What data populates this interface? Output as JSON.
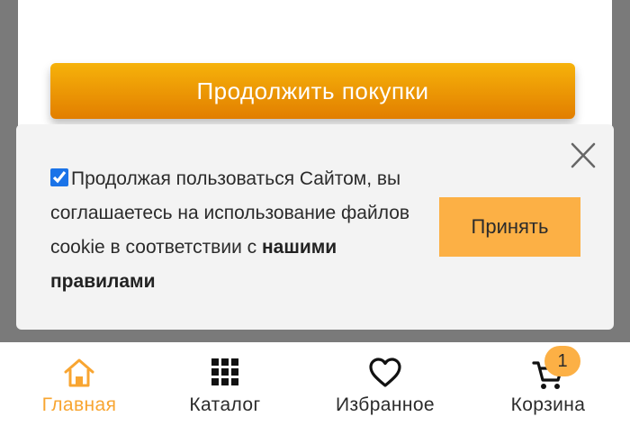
{
  "page": {
    "continue_button_label": "Продолжить покупки"
  },
  "cookie_banner": {
    "checkbox_checked": true,
    "text_part1": "Продолжая пользоваться Сайтом, вы соглашаетесь на использование файлов cookie в соответствии с ",
    "rules_link": "нашими правилами",
    "accept_label": "Принять",
    "close_icon": "close-icon"
  },
  "bottom_nav": {
    "items": [
      {
        "label": "Главная",
        "icon": "home-icon",
        "active": true
      },
      {
        "label": "Каталог",
        "icon": "grid-icon",
        "active": false
      },
      {
        "label": "Избранное",
        "icon": "heart-icon",
        "active": false
      },
      {
        "label": "Корзина",
        "icon": "cart-icon",
        "active": false
      }
    ],
    "cart_count": "1"
  },
  "colors": {
    "accent": "#f8a531",
    "button_gradient_top": "#f6b20a",
    "button_gradient_bottom": "#e27e00",
    "accept_button": "#fcb045",
    "panel_bg": "#f3f3f3"
  }
}
